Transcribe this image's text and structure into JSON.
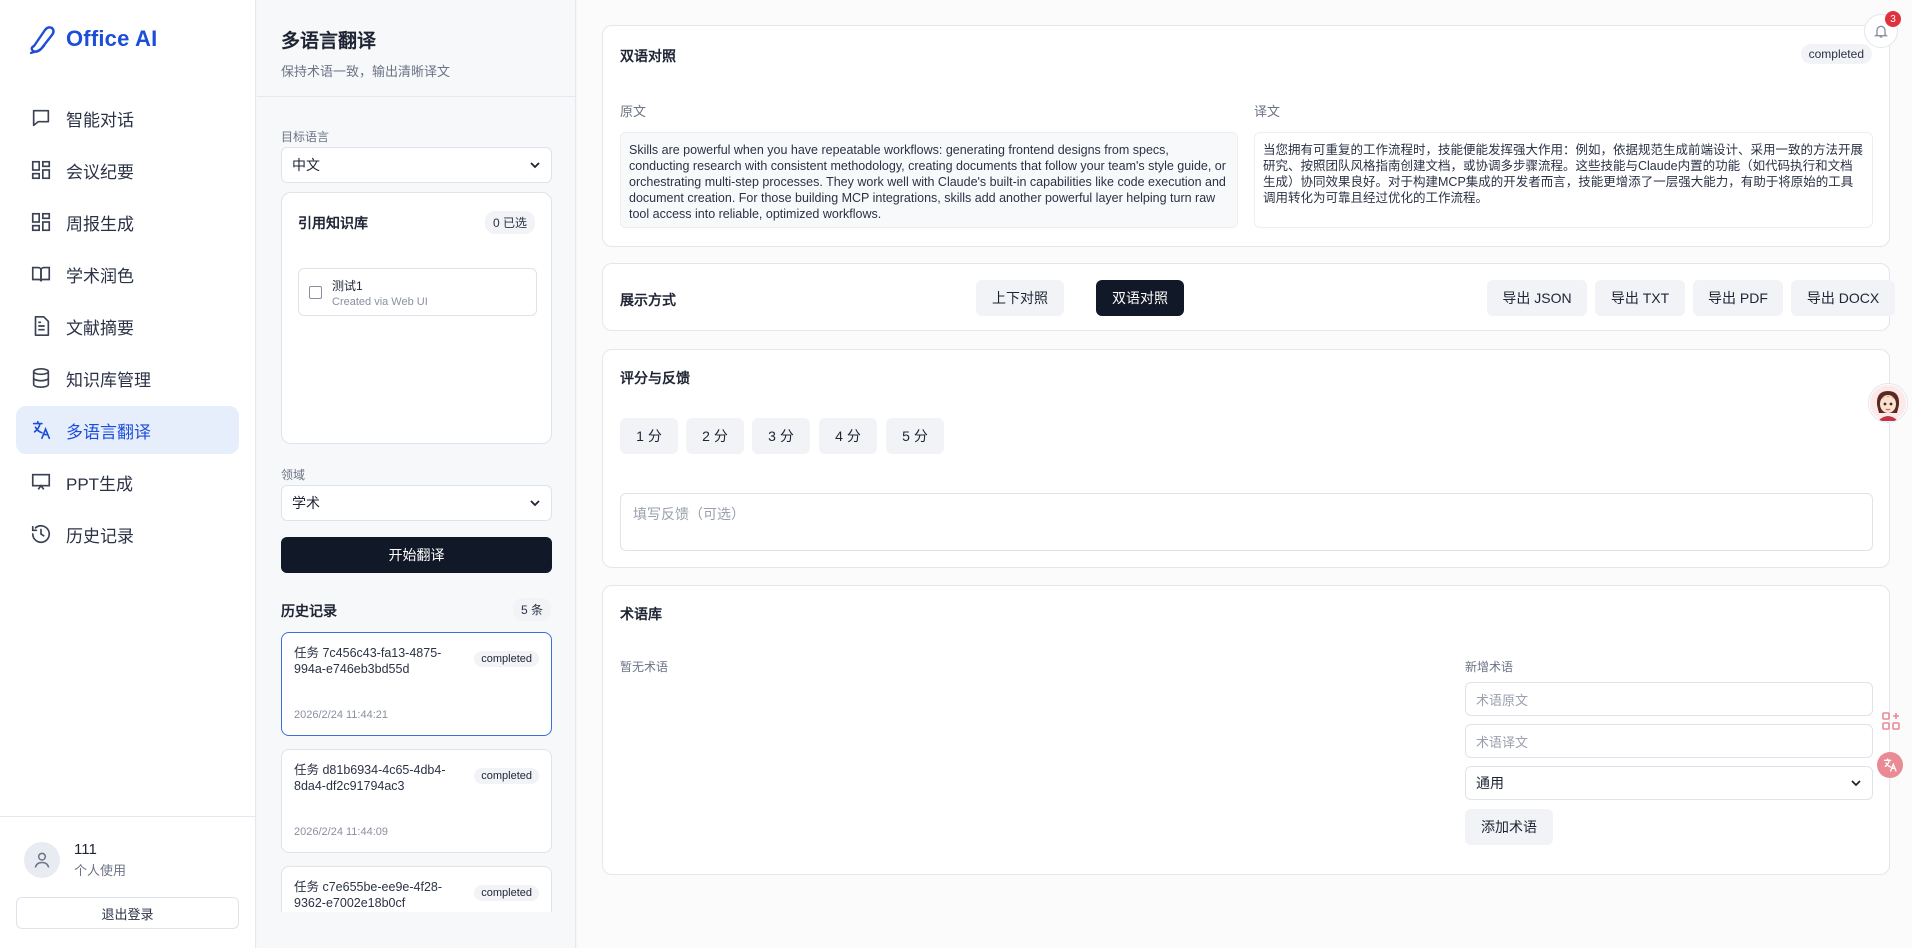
{
  "app": {
    "brand": "Office AI"
  },
  "sidebar": {
    "items": [
      {
        "label": "智能对话",
        "icon": "chat-icon"
      },
      {
        "label": "会议纪要",
        "icon": "grid-icon"
      },
      {
        "label": "周报生成",
        "icon": "grid-icon"
      },
      {
        "label": "学术润色",
        "icon": "book-icon"
      },
      {
        "label": "文献摘要",
        "icon": "document-icon"
      },
      {
        "label": "知识库管理",
        "icon": "database-icon"
      },
      {
        "label": "多语言翻译",
        "icon": "translate-icon",
        "active": true
      },
      {
        "label": "PPT生成",
        "icon": "presentation-icon"
      },
      {
        "label": "历史记录",
        "icon": "history-icon"
      }
    ],
    "user": {
      "name": "111",
      "role": "个人使用"
    },
    "logout_label": "退出登录"
  },
  "config": {
    "title": "多语言翻译",
    "subtitle": "保持术语一致，输出清晰译文",
    "target_lang_label": "目标语言",
    "target_lang_value": "中文",
    "kb": {
      "title": "引用知识库",
      "count": "0 已选",
      "item_name": "测试1",
      "item_desc": "Created via Web UI"
    },
    "domain_label": "领域",
    "domain_value": "学术",
    "start_label": "开始翻译",
    "history": {
      "title": "历史记录",
      "count": "5 条",
      "items": [
        {
          "id": "任务 7c456c43-fa13-4875-994a-e746eb3bd55d",
          "status": "completed",
          "time": "2026/2/24 11:44:21"
        },
        {
          "id": "任务 d81b6934-4c65-4db4-8da4-df2c91794ac3",
          "status": "completed",
          "time": "2026/2/24 11:44:09"
        },
        {
          "id": "任务 c7e655be-ee9e-4f28-9362-e7002e18b0cf",
          "status": "completed",
          "time": ""
        }
      ]
    }
  },
  "bilingual": {
    "title": "双语对照",
    "status": "completed",
    "source_label": "原文",
    "target_label": "译文",
    "source_text": "Skills are powerful when you have repeatable workflows: generating frontend  designs from specs, conducting research with consistent methodology, creating  documents that follow your team's style guide, or orchestrating multi-step  processes. They work well with Claude's built-in capabilities like code execution  and document creation. For those building MCP integrations, skills add another  powerful layer helping turn raw tool access into reliable, optimized workflows.",
    "target_text": "当您拥有可重复的工作流程时，技能便能发挥强大作用：例如，依据规范生成前端设计、采用一致的方法开展研究、按照团队风格指南创建文档，或协调多步骤流程。这些技能与Claude内置的功能（如代码执行和文档生成）协同效果良好。对于构建MCP集成的开发者而言，技能更增添了一层强大能力，有助于将原始的工具调用转化为可靠且经过优化的工作流程。"
  },
  "display": {
    "title": "展示方式",
    "modes": [
      "上下对照",
      "双语对照"
    ],
    "active_mode": "双语对照",
    "exports": [
      "导出 JSON",
      "导出 TXT",
      "导出 PDF",
      "导出 DOCX"
    ]
  },
  "rating": {
    "title": "评分与反馈",
    "scores": [
      "1 分",
      "2 分",
      "3 分",
      "4 分",
      "5 分"
    ],
    "feedback_placeholder": "填写反馈（可选）"
  },
  "glossary": {
    "title": "术语库",
    "empty_text": "暂无术语",
    "new_label": "新增术语",
    "source_placeholder": "术语原文",
    "target_placeholder": "术语译文",
    "category_value": "通用",
    "add_label": "添加术语"
  },
  "notifications": {
    "count": "3"
  },
  "colors": {
    "accent": "#1d4ed8",
    "primary_button": "#111827",
    "active_nav_bg": "#e6eefc",
    "notification_badge": "#e0323c"
  }
}
